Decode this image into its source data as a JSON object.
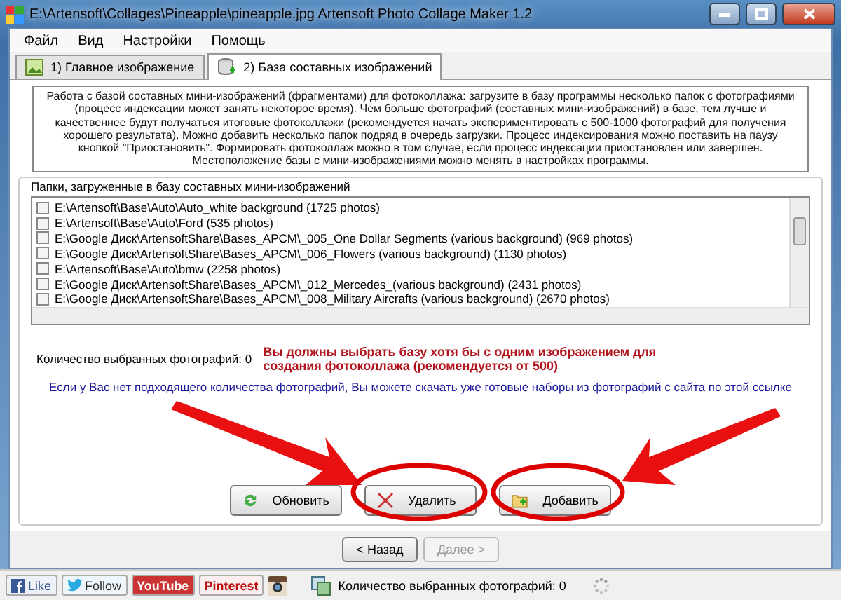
{
  "window": {
    "title": "E:\\Artensoft\\Collages\\Pineapple\\pineapple.jpg Artensoft Photo Collage Maker 1.2"
  },
  "menu": [
    "Файл",
    "Вид",
    "Настройки",
    "Помощь"
  ],
  "tabs": [
    {
      "label": "1) Главное изображение",
      "selected": false,
      "kind": "image"
    },
    {
      "label": "2) База составных изображений",
      "selected": true,
      "kind": "database"
    }
  ],
  "info": "Работа с базой составных мини-изображений (фрагментами) для фотоколлажа: загрузите в базу программы несколько папок с фотографиями (процесс индексации может занять некоторое время). Чем больше фотографий (составных мини-изображений) в базе, тем лучше и качественнее будут получаться итоговые фотоколлажи (рекомендуется начать экспериментировать с 500-1000 фотографий для получения хорошего результата). Можно добавить несколько папок подряд в очередь загрузки. Процесс индексирования можно поставить на паузу кнопкой \"Приостановить\". Формировать фотоколлаж можно в том случае, если процесс индексации приостановлен или завершен. Местоположение базы с мини-изображениями можно менять в настройках программы.",
  "folders": {
    "title": "Папки, загруженные в базу составных мини-изображений",
    "items": [
      {
        "path": "E:\\Artensoft\\Base\\Auto\\Auto_white background (1725 photos)",
        "checked": false
      },
      {
        "path": "E:\\Artensoft\\Base\\Auto\\Ford (535 photos)",
        "checked": false
      },
      {
        "path": "E:\\Google Диск\\ArtensoftShare\\Bases_APCM\\_005_One Dollar Segments (various background) (969 photos)",
        "checked": false
      },
      {
        "path": "E:\\Google Диск\\ArtensoftShare\\Bases_APCM\\_006_Flowers (various background) (1130 photos)",
        "checked": false
      },
      {
        "path": "E:\\Artensoft\\Base\\Auto\\bmw (2258 photos)",
        "checked": false
      },
      {
        "path": "E:\\Google Диск\\ArtensoftShare\\Bases_APCM\\_012_Mercedes_(various background) (2431 photos)",
        "checked": false
      },
      {
        "path": "E:\\Google Диск\\ArtensoftShare\\Bases_APCM\\_008_Military Aircrafts (various background) (2670 photos)",
        "checked": false
      }
    ],
    "count_label": "Количество выбранных фотографий: 0",
    "warning": "Вы должны выбрать базу хотя бы с одним изображением для создания фотоколлажа (рекомендуется от 500)",
    "link": "Если у Вас нет подходящего количества фотографий, Вы можете скачать уже готовые наборы из фотографий с сайта по этой ссылке",
    "buttons": [
      {
        "label": "Обновить",
        "kind": "refresh"
      },
      {
        "label": "Удалить",
        "kind": "delete"
      },
      {
        "label": "Добавить",
        "kind": "add"
      }
    ]
  },
  "nav": [
    {
      "label": "< Назад",
      "disabled": false
    },
    {
      "label": "Далее >",
      "disabled": true
    }
  ],
  "status_bar": {
    "social": [
      {
        "label": "Like",
        "kind": "facebook"
      },
      {
        "label": "Follow",
        "kind": "twitter"
      },
      {
        "label": "YouTube",
        "kind": "youtube"
      },
      {
        "label": "Pinterest",
        "kind": "pinterest"
      },
      {
        "kind": "instagram"
      }
    ],
    "count": "Количество выбранных фотографий: 0"
  }
}
